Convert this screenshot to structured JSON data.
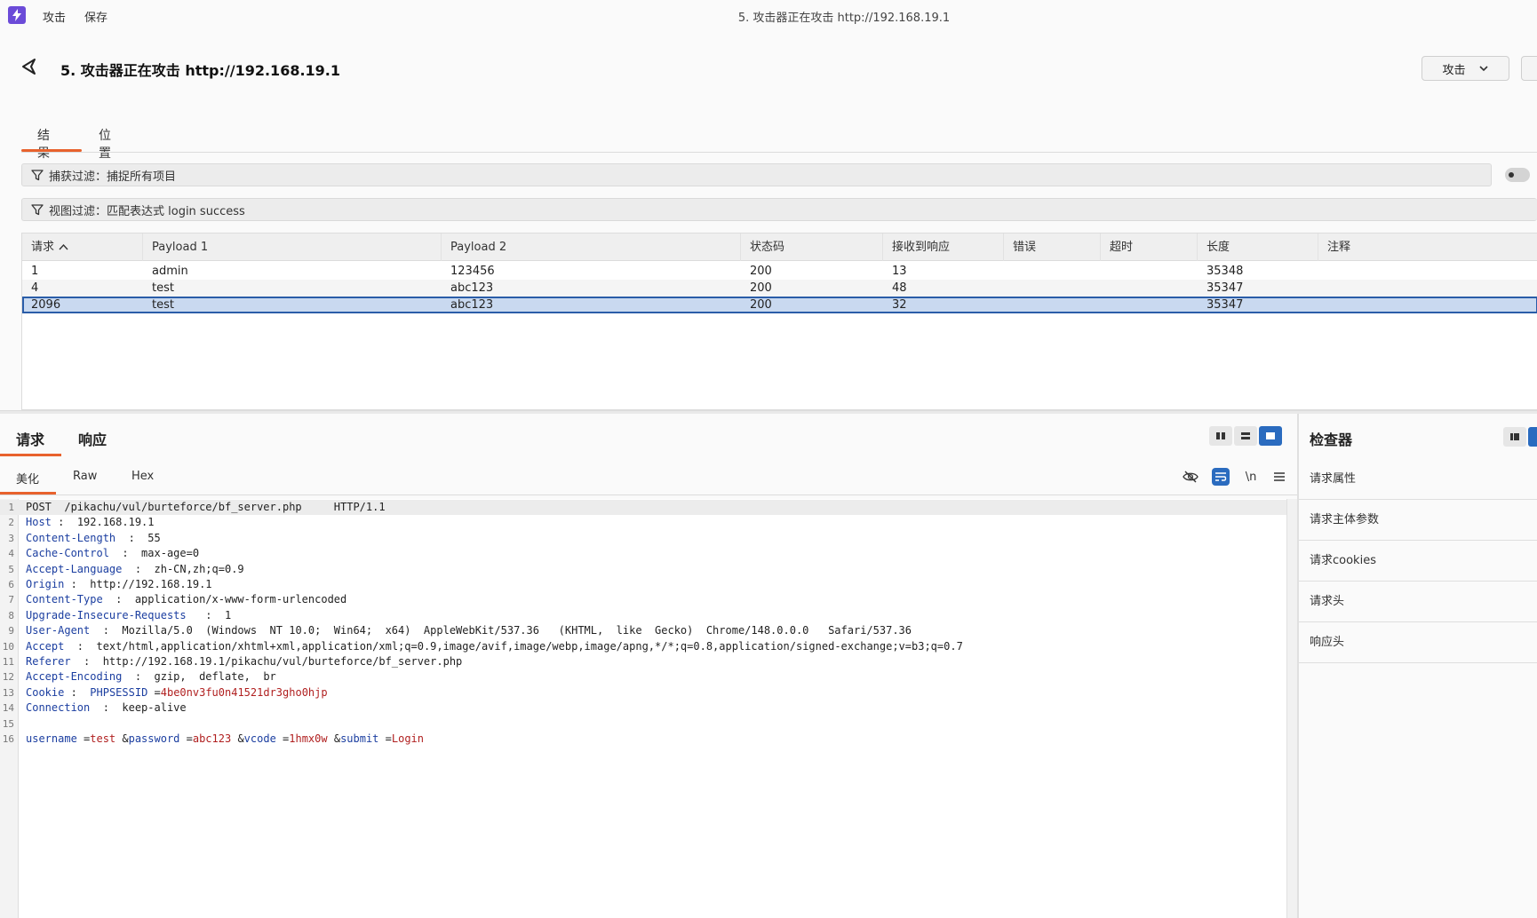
{
  "titlebar": {
    "menu": [
      "攻击",
      "保存"
    ],
    "window_title": "5. 攻击器正在攻击 http://192.168.19.1"
  },
  "header": {
    "title": "5. 攻击器正在攻击 http://192.168.19.1",
    "attack_button": "攻击"
  },
  "tabs": [
    {
      "label": "结果",
      "active": true
    },
    {
      "label": "位置",
      "active": false
    }
  ],
  "filters": {
    "capture": "捕获过滤：捕捉所有项目",
    "view": "视图过滤：匹配表达式 login success"
  },
  "table": {
    "columns": [
      "请求",
      "Payload 1",
      "Payload 2",
      "状态码",
      "接收到响应",
      "错误",
      "超时",
      "长度",
      "注释"
    ],
    "sort_indicator": "^",
    "rows": [
      {
        "request": "1",
        "payload1": "admin",
        "payload2": "123456",
        "status": "200",
        "received": "13",
        "error": "",
        "timeout": "",
        "length": "35348",
        "comment": ""
      },
      {
        "request": "4",
        "payload1": "test",
        "payload2": "abc123",
        "status": "200",
        "received": "48",
        "error": "",
        "timeout": "",
        "length": "35347",
        "comment": ""
      },
      {
        "request": "2096",
        "payload1": "test",
        "payload2": "abc123",
        "status": "200",
        "received": "32",
        "error": "",
        "timeout": "",
        "length": "35347",
        "comment": ""
      }
    ],
    "selected_row": 2
  },
  "message_tabs": [
    {
      "label": "请求",
      "active": true
    },
    {
      "label": "响应",
      "active": false
    }
  ],
  "view_tabs": [
    {
      "label": "美化",
      "active": true
    },
    {
      "label": "Raw",
      "active": false
    },
    {
      "label": "Hex",
      "active": false
    }
  ],
  "editor_icons": {
    "newline": "\\n"
  },
  "request_lines": [
    {
      "n": "1",
      "text": "POST  /pikachu/vul/burteforce/bf_server.php     HTTP/1.1"
    },
    {
      "n": "2",
      "key": "Host",
      "sep": " :  ",
      "val": "192.168.19.1"
    },
    {
      "n": "3",
      "key": "Content-Length",
      "sep": "  :  ",
      "val": "55"
    },
    {
      "n": "4",
      "key": "Cache-Control",
      "sep": "  :  ",
      "val": "max-age=0"
    },
    {
      "n": "5",
      "key": "Accept-Language",
      "sep": "  :  ",
      "val": "zh-CN,zh;q=0.9"
    },
    {
      "n": "6",
      "key": "Origin",
      "sep": " :  ",
      "val": "http://192.168.19.1"
    },
    {
      "n": "7",
      "key": "Content-Type",
      "sep": "  :  ",
      "val": "application/x-www-form-urlencoded"
    },
    {
      "n": "8",
      "key": "Upgrade-Insecure-Requests",
      "sep": "   :  ",
      "val": "1"
    },
    {
      "n": "9",
      "key": "User-Agent",
      "sep": "  :  ",
      "val": "Mozilla/5.0  (Windows  NT 10.0;  Win64;  x64)  AppleWebKit/537.36   (KHTML,  like  Gecko)  Chrome/148.0.0.0   Safari/537.36"
    },
    {
      "n": "10",
      "key": "Accept",
      "sep": "  :  ",
      "val": "text/html,application/xhtml+xml,application/xml;q=0.9,image/avif,image/webp,image/apng,*/*;q=0.8,application/signed-exchange;v=b3;q=0.7"
    },
    {
      "n": "11",
      "key": "Referer",
      "sep": "  :  ",
      "val": "http://192.168.19.1/pikachu/vul/burteforce/bf_server.php"
    },
    {
      "n": "12",
      "key": "Accept-Encoding",
      "sep": "  :  ",
      "val": "gzip,  deflate,  br"
    },
    {
      "n": "13",
      "key": "Cookie",
      "sep": " :  ",
      "cookie_name": "PHPSESSID",
      "cookie_val": "4be0nv3fu0n41521dr3gho0hjp"
    },
    {
      "n": "14",
      "key": "Connection",
      "sep": "  :  ",
      "val": "keep-alive"
    },
    {
      "n": "15",
      "text": ""
    },
    {
      "n": "16",
      "params": [
        {
          "name": "username",
          "value": "test"
        },
        {
          "name": "password",
          "value": "abc123"
        },
        {
          "name": "vcode",
          "value": "1hmx0w"
        },
        {
          "name": "submit",
          "value": "Login"
        }
      ]
    }
  ],
  "inspector": {
    "title": "检查器",
    "items": [
      "请求属性",
      "请求主体参数",
      "请求cookies",
      "请求头",
      "响应头"
    ]
  },
  "colors": {
    "accent": "#e8622d",
    "selection": "#c9d9f0",
    "selection_border": "#2a5da8",
    "header_key": "#1b3ea0",
    "param_value": "#b01f1f",
    "toggle_on": "#2a6bbf",
    "logo": "#6b4bd8"
  }
}
